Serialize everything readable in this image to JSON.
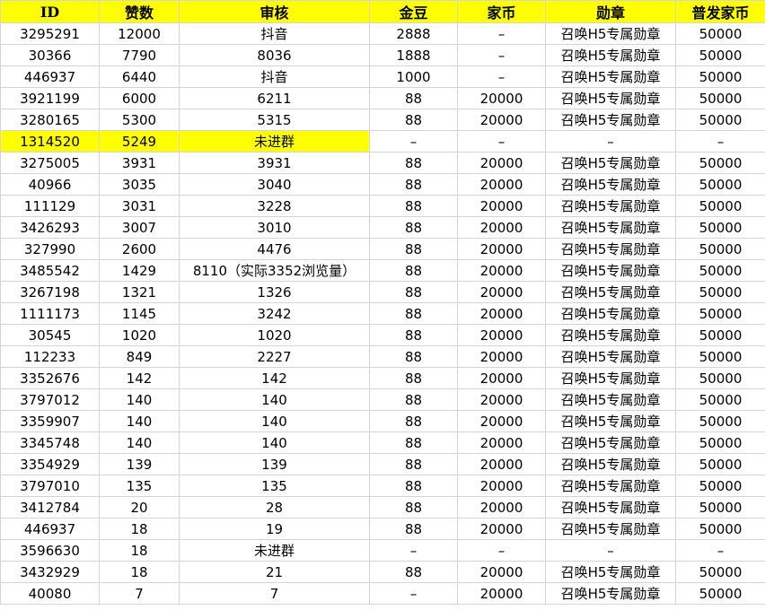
{
  "colors": {
    "header_background": "#ffff00",
    "highlight_background": "#ffff00",
    "gridline": "#d4d4d4"
  },
  "headers": [
    "ID",
    "赞数",
    "审核",
    "金豆",
    "家币",
    "勋章",
    "普发家币"
  ],
  "rows": [
    {
      "cells": [
        "3295291",
        "12000",
        "抖音",
        "2888",
        "–",
        "召唤H5专属勋章",
        "50000"
      ],
      "highlight": false
    },
    {
      "cells": [
        "30366",
        "7790",
        "8036",
        "1888",
        "–",
        "召唤H5专属勋章",
        "50000"
      ],
      "highlight": false
    },
    {
      "cells": [
        "446937",
        "6440",
        "抖音",
        "1000",
        "–",
        "召唤H5专属勋章",
        "50000"
      ],
      "highlight": false
    },
    {
      "cells": [
        "3921199",
        "6000",
        "6211",
        "88",
        "20000",
        "召唤H5专属勋章",
        "50000"
      ],
      "highlight": false
    },
    {
      "cells": [
        "3280165",
        "5300",
        "5315",
        "88",
        "20000",
        "召唤H5专属勋章",
        "50000"
      ],
      "highlight": false
    },
    {
      "cells": [
        "1314520",
        "5249",
        "未进群",
        "–",
        "–",
        "–",
        "–"
      ],
      "highlight": true
    },
    {
      "cells": [
        "3275005",
        "3931",
        "3931",
        "88",
        "20000",
        "召唤H5专属勋章",
        "50000"
      ],
      "highlight": false
    },
    {
      "cells": [
        "40966",
        "3035",
        "3040",
        "88",
        "20000",
        "召唤H5专属勋章",
        "50000"
      ],
      "highlight": false
    },
    {
      "cells": [
        "111129",
        "3031",
        "3228",
        "88",
        "20000",
        "召唤H5专属勋章",
        "50000"
      ],
      "highlight": false
    },
    {
      "cells": [
        "3426293",
        "3007",
        "3010",
        "88",
        "20000",
        "召唤H5专属勋章",
        "50000"
      ],
      "highlight": false
    },
    {
      "cells": [
        "327990",
        "2600",
        "4476",
        "88",
        "20000",
        "召唤H5专属勋章",
        "50000"
      ],
      "highlight": false
    },
    {
      "cells": [
        "3485542",
        "1429",
        "8110（实际3352浏览量）",
        "88",
        "20000",
        "召唤H5专属勋章",
        "50000"
      ],
      "highlight": false
    },
    {
      "cells": [
        "3267198",
        "1321",
        "1326",
        "88",
        "20000",
        "召唤H5专属勋章",
        "50000"
      ],
      "highlight": false
    },
    {
      "cells": [
        "1111173",
        "1145",
        "3242",
        "88",
        "20000",
        "召唤H5专属勋章",
        "50000"
      ],
      "highlight": false
    },
    {
      "cells": [
        "30545",
        "1020",
        "1020",
        "88",
        "20000",
        "召唤H5专属勋章",
        "50000"
      ],
      "highlight": false
    },
    {
      "cells": [
        "112233",
        "849",
        "2227",
        "88",
        "20000",
        "召唤H5专属勋章",
        "50000"
      ],
      "highlight": false
    },
    {
      "cells": [
        "3352676",
        "142",
        "142",
        "88",
        "20000",
        "召唤H5专属勋章",
        "50000"
      ],
      "highlight": false
    },
    {
      "cells": [
        "3797012",
        "140",
        "140",
        "88",
        "20000",
        "召唤H5专属勋章",
        "50000"
      ],
      "highlight": false
    },
    {
      "cells": [
        "3359907",
        "140",
        "140",
        "88",
        "20000",
        "召唤H5专属勋章",
        "50000"
      ],
      "highlight": false
    },
    {
      "cells": [
        "3345748",
        "140",
        "140",
        "88",
        "20000",
        "召唤H5专属勋章",
        "50000"
      ],
      "highlight": false
    },
    {
      "cells": [
        "3354929",
        "139",
        "139",
        "88",
        "20000",
        "召唤H5专属勋章",
        "50000"
      ],
      "highlight": false
    },
    {
      "cells": [
        "3797010",
        "135",
        "135",
        "88",
        "20000",
        "召唤H5专属勋章",
        "50000"
      ],
      "highlight": false
    },
    {
      "cells": [
        "3412784",
        "20",
        "28",
        "88",
        "20000",
        "召唤H5专属勋章",
        "50000"
      ],
      "highlight": false
    },
    {
      "cells": [
        "446937",
        "18",
        "19",
        "88",
        "20000",
        "召唤H5专属勋章",
        "50000"
      ],
      "highlight": false
    },
    {
      "cells": [
        "3596630",
        "18",
        "未进群",
        "–",
        "–",
        "–",
        "–"
      ],
      "highlight": false
    },
    {
      "cells": [
        "3432929",
        "18",
        "21",
        "88",
        "20000",
        "召唤H5专属勋章",
        "50000"
      ],
      "highlight": false
    },
    {
      "cells": [
        "40080",
        "7",
        "7",
        "–",
        "20000",
        "召唤H5专属勋章",
        "50000"
      ],
      "highlight": false
    }
  ]
}
